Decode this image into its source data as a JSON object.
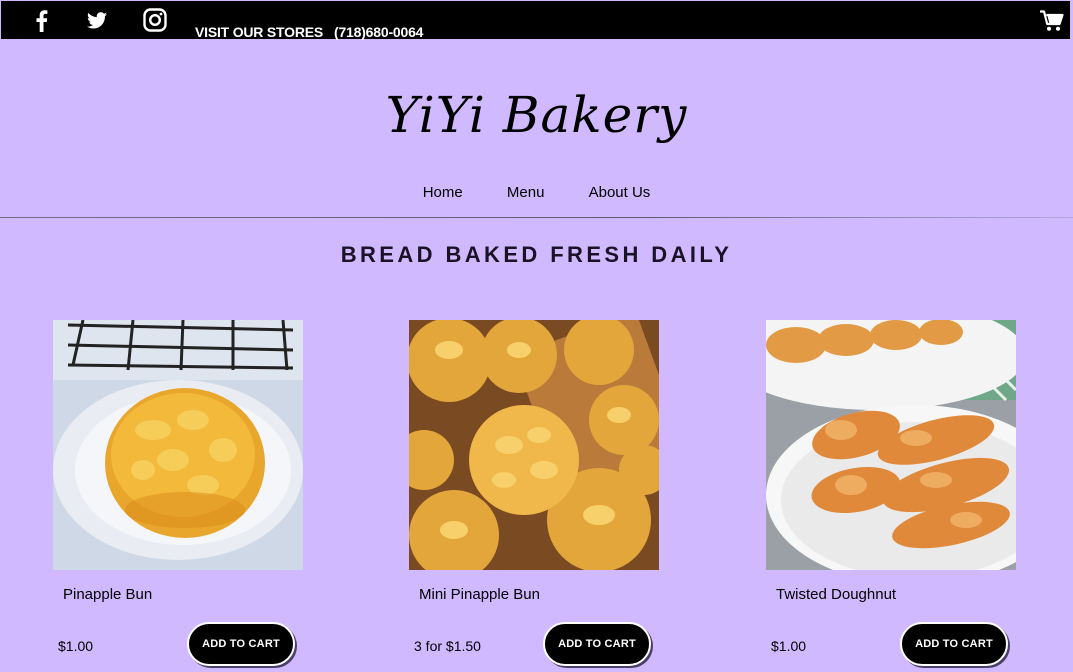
{
  "topbar": {
    "social_icons": [
      "facebook-icon",
      "twitter-icon",
      "instagram-icon"
    ],
    "stores_link": "VISIT OUR STORES",
    "phone": "(718)680-0064",
    "cart_icon": "cart-icon"
  },
  "header": {
    "brand": "YiYi Bakery"
  },
  "nav": {
    "items": [
      "Home",
      "Menu",
      "About Us"
    ]
  },
  "main": {
    "headline": "BREAD BAKED FRESH DAILY",
    "products": [
      {
        "name": "Pinapple Bun",
        "price": "$1.00",
        "button": "ADD TO CART"
      },
      {
        "name": "Mini Pinapple Bun",
        "price": "3 for $1.50",
        "button": "ADD TO CART"
      },
      {
        "name": "Twisted Doughnut",
        "price": "$1.00",
        "button": "ADD TO CART"
      }
    ]
  },
  "colors": {
    "background": "#d0b9fe",
    "topbar": "#000000",
    "button": "#000000"
  }
}
